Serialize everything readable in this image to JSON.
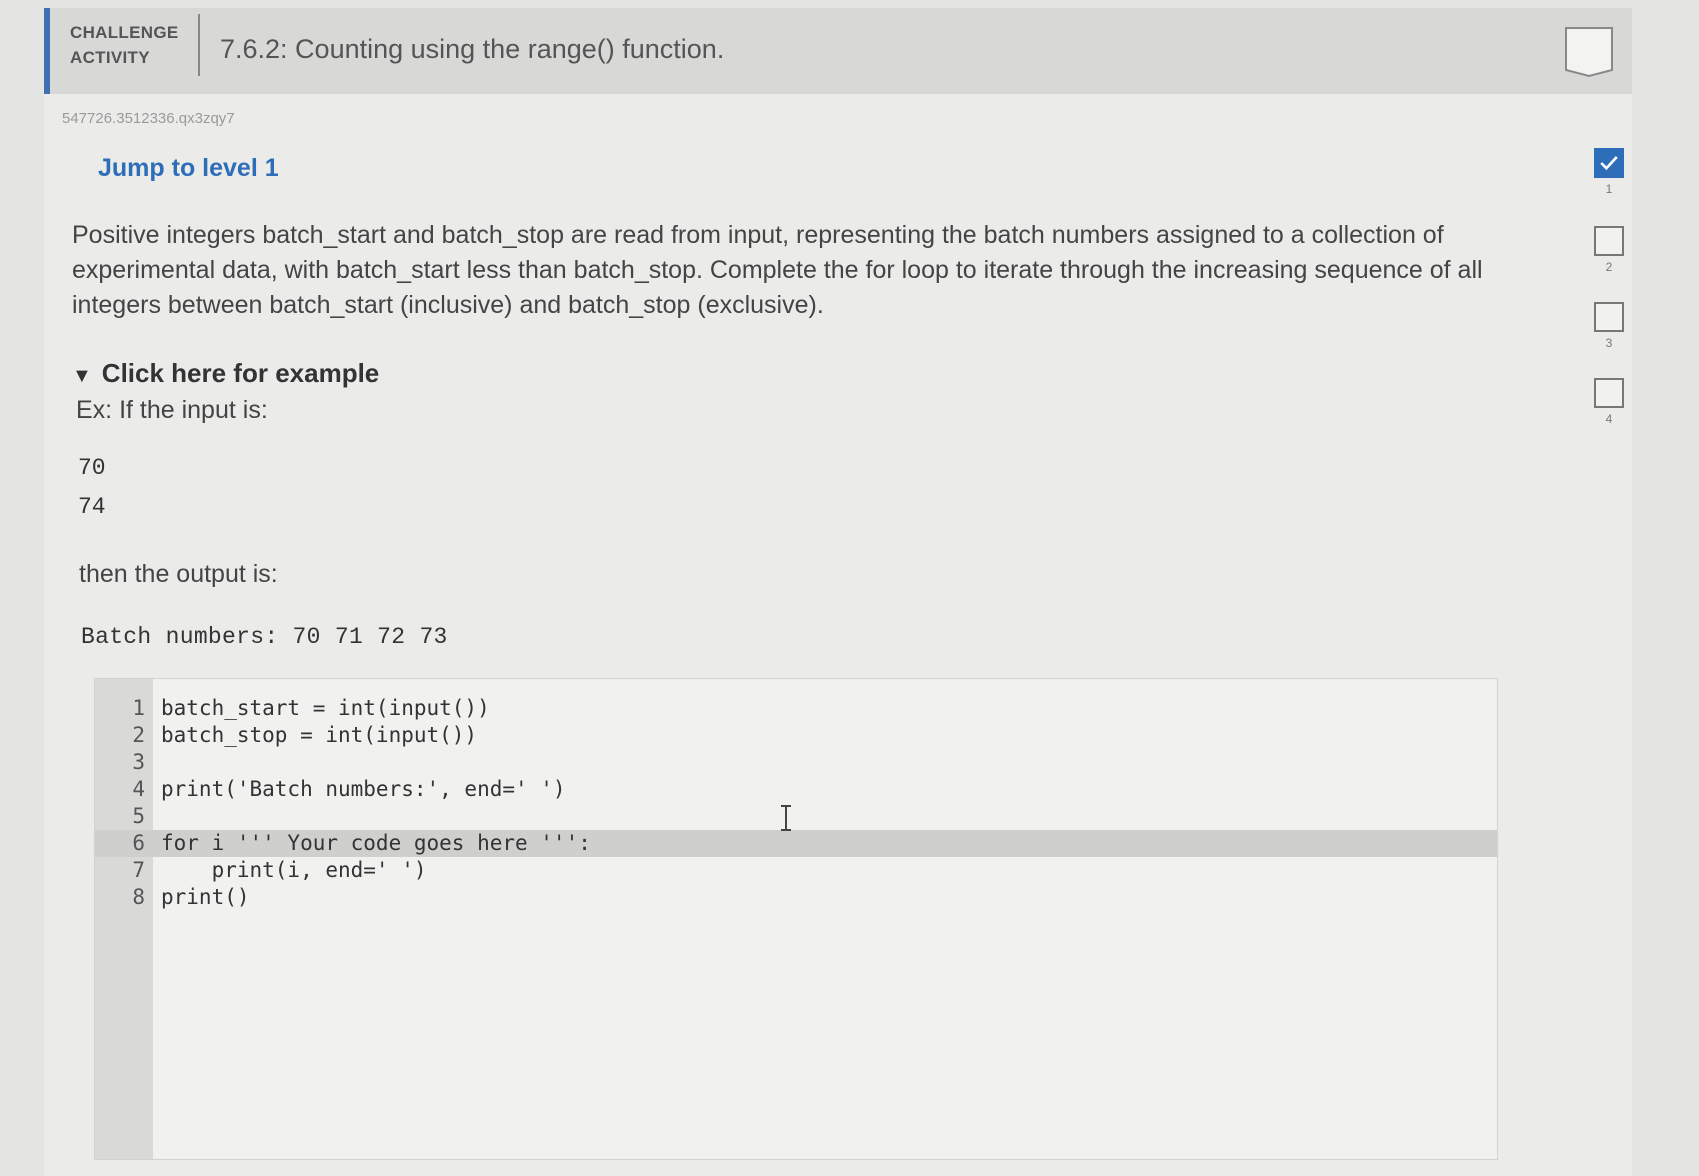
{
  "header": {
    "activity_type_line1": "CHALLENGE",
    "activity_type_line2": "ACTIVITY",
    "title": "7.6.2: Counting using the range() function."
  },
  "activity_id": "547726.3512336.qx3zqy7",
  "jump_label": "Jump to level 1",
  "description": "Positive integers batch_start and batch_stop are read from input, representing the batch numbers assigned to a collection of experimental data, with batch_start less than batch_stop. Complete the for loop to iterate through the increasing sequence of all integers between batch_start (inclusive) and batch_stop (exclusive).",
  "example": {
    "toggle_label": "Click here for example",
    "intro": "Ex: If the input is:",
    "inputs": [
      "70",
      "74"
    ],
    "then_text": "then the output is:",
    "output": "Batch numbers: 70 71 72 73"
  },
  "editor": {
    "lines": [
      {
        "num": "1",
        "code": "batch_start = int(input())"
      },
      {
        "num": "2",
        "code": "batch_stop = int(input())"
      },
      {
        "num": "3",
        "code": ""
      },
      {
        "num": "4",
        "code": "print('Batch numbers:', end=' ')"
      },
      {
        "num": "5",
        "code": ""
      },
      {
        "num": "6",
        "code": "for i ''' Your code goes here ''':"
      },
      {
        "num": "7",
        "code": "    print(i, end=' ')"
      },
      {
        "num": "8",
        "code": "print()"
      }
    ],
    "active_line": 6
  },
  "levels": [
    {
      "label": "1",
      "completed": true
    },
    {
      "label": "2",
      "completed": false
    },
    {
      "label": "3",
      "completed": false
    },
    {
      "label": "4",
      "completed": false
    }
  ],
  "colors": {
    "accent": "#2e6db8",
    "header_bar": "#3f6fb3"
  },
  "icons": {
    "badge": "shield-badge-icon",
    "check": "check-icon",
    "cursor": "text-cursor-icon"
  }
}
